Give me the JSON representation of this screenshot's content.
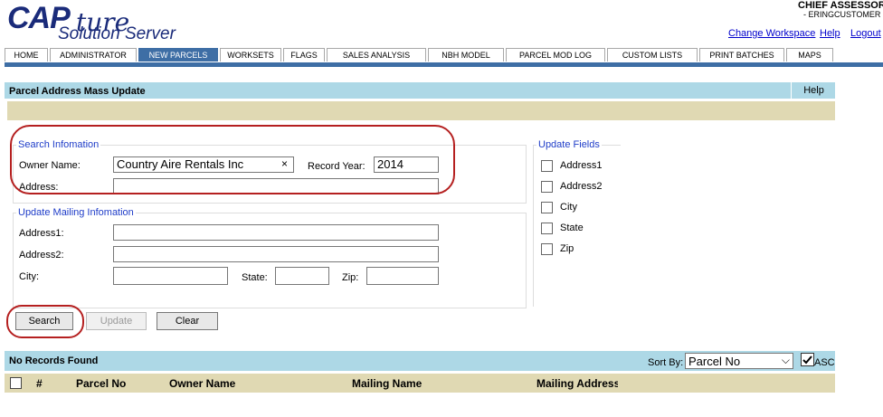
{
  "header": {
    "logo_cap": "CAP",
    "logo_ture": "ture",
    "logo_sub": "Solution Server",
    "user_name": "CHIEF  ASSESSOR",
    "user_sub": "- ERINGCUSTOMER",
    "change_workspace": "Change Workspace",
    "help": "Help",
    "logout": "Logout"
  },
  "nav": {
    "tabs": [
      "HOME",
      "ADMINISTRATOR",
      "NEW PARCELS",
      "WORKSETS",
      "FLAGS",
      "SALES ANALYSIS",
      "NBH MODEL",
      "PARCEL MOD LOG",
      "CUSTOM LISTS",
      "PRINT BATCHES",
      "MAPS"
    ],
    "active": "NEW PARCELS"
  },
  "panel": {
    "title": "Parcel Address Mass Update",
    "help": "Help"
  },
  "search_info": {
    "legend": "Search Infomation",
    "owner_label": "Owner Name:",
    "owner_value": "Country Aire Rentals Inc",
    "clear_glyph": "×",
    "year_label": "Record Year:",
    "year_value": "2014",
    "address_label": "Address:",
    "address_value": ""
  },
  "update_mailing": {
    "legend": "Update Mailing Infomation",
    "address1_label": "Address1:",
    "address2_label": "Address2:",
    "city_label": "City:",
    "state_label": "State:",
    "zip_label": "Zip:"
  },
  "update_fields": {
    "legend": "Update Fields",
    "items": [
      "Address1",
      "Address2",
      "City",
      "State",
      "Zip"
    ]
  },
  "buttons": {
    "search": "Search",
    "update": "Update",
    "clear": "Clear"
  },
  "results": {
    "status": "No Records Found",
    "sort_label": "Sort By:",
    "sort_value": "Parcel No",
    "asc_label": "ASC",
    "asc_checked": true,
    "columns": [
      "#",
      "Parcel No",
      "Owner Name",
      "Mailing Name",
      "Mailing Address"
    ]
  },
  "colors": {
    "nav_active": "#3e6ea5",
    "panel_header": "#add8e6",
    "tan": "#e0d9b3",
    "legend": "#1e3cc8",
    "highlight_oval": "#b52020"
  }
}
